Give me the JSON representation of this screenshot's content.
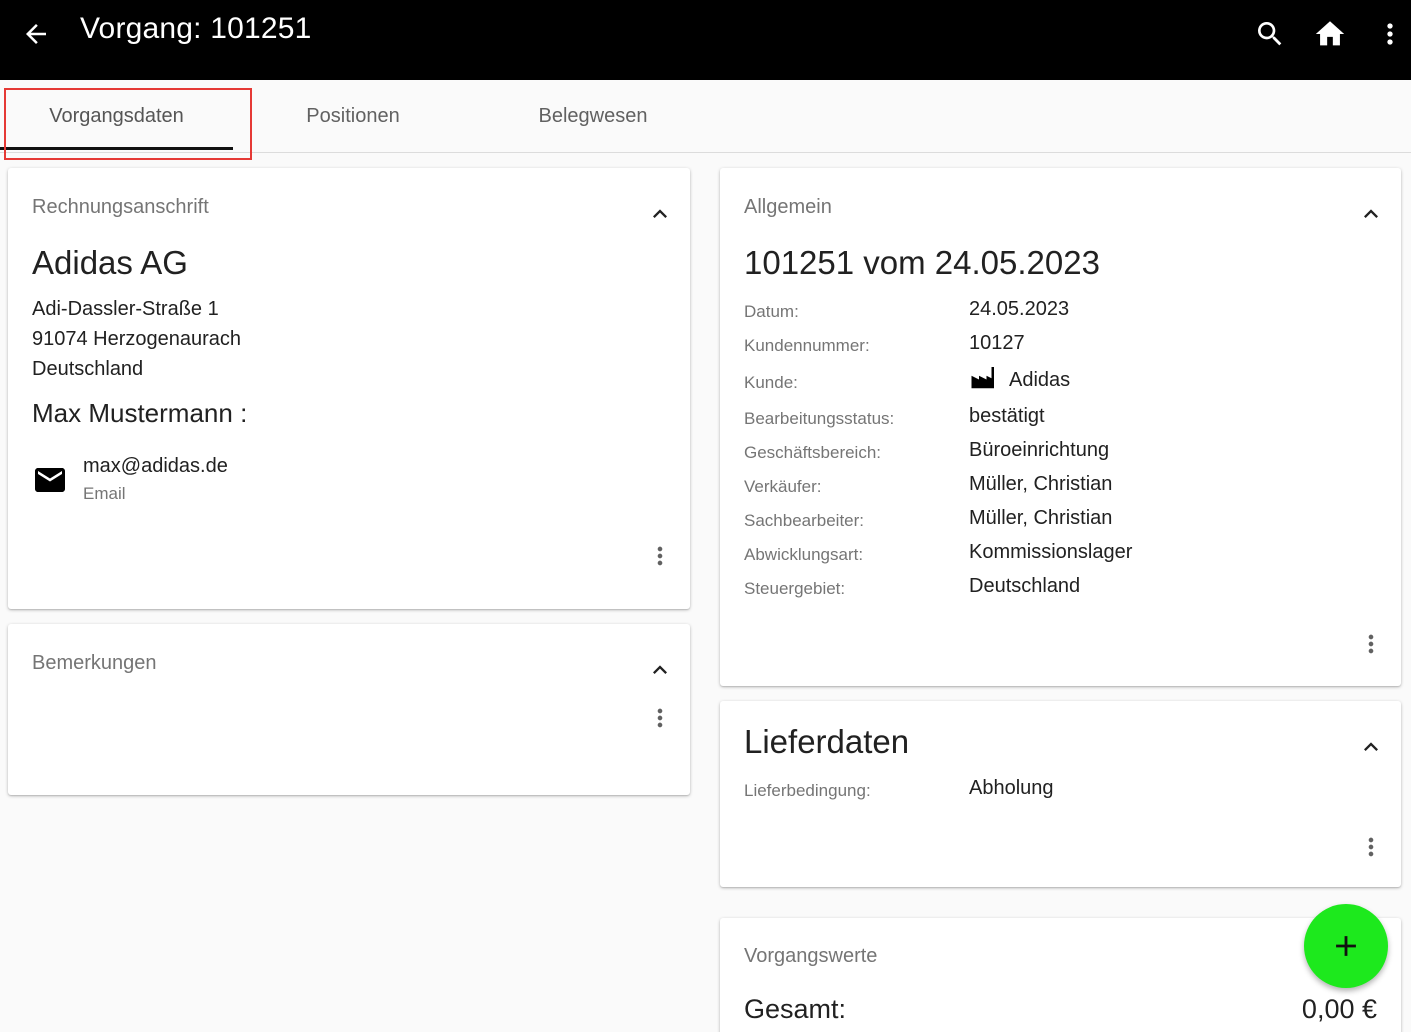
{
  "appbar": {
    "title": "Vorgang: 101251",
    "back_icon": "arrow-back-icon",
    "actions": [
      "search-icon",
      "home-icon",
      "more-vert-icon"
    ]
  },
  "tabs": [
    {
      "label": "Vorgangsdaten",
      "active": true
    },
    {
      "label": "Positionen",
      "active": false
    },
    {
      "label": "Belegwesen",
      "active": false
    }
  ],
  "billing": {
    "section_label": "Rechnungsanschrift",
    "company": "Adidas AG",
    "street": "Adi-Dassler-Straße 1",
    "city": "91074 Herzogenaurach",
    "country": "Deutschland",
    "contact_name": "Max Mustermann :",
    "email": "max@adidas.de",
    "email_label": "Email"
  },
  "remarks": {
    "section_label": "Bemerkungen"
  },
  "general": {
    "section_label": "Allgemein",
    "heading": "101251 vom 24.05.2023",
    "fields": [
      {
        "key": "Datum:",
        "value": "24.05.2023"
      },
      {
        "key": "Kundennummer:",
        "value": "10127"
      },
      {
        "key": "Kunde:",
        "value": "Adidas",
        "icon": "factory-icon"
      },
      {
        "key": "Bearbeitungsstatus:",
        "value": "bestätigt"
      },
      {
        "key": "Geschäftsbereich:",
        "value": "Büroeinrichtung"
      },
      {
        "key": "Verkäufer:",
        "value": "Müller, Christian"
      },
      {
        "key": "Sachbearbeiter:",
        "value": "Müller, Christian"
      },
      {
        "key": "Abwicklungsart:",
        "value": "Kommissionslager"
      },
      {
        "key": "Steuergebiet:",
        "value": "Deutschland"
      }
    ]
  },
  "delivery": {
    "section_label": "Lieferdaten",
    "fields": [
      {
        "key": "Lieferbedingung:",
        "value": "Abholung"
      }
    ]
  },
  "values": {
    "section_label": "Vorgangswerte",
    "total_label": "Gesamt:",
    "total_value": "0,00 €"
  },
  "fab": {
    "icon": "add-icon",
    "color": "#1de91d"
  },
  "colors": {
    "appbar": "#000000",
    "highlight": "#e53935"
  }
}
